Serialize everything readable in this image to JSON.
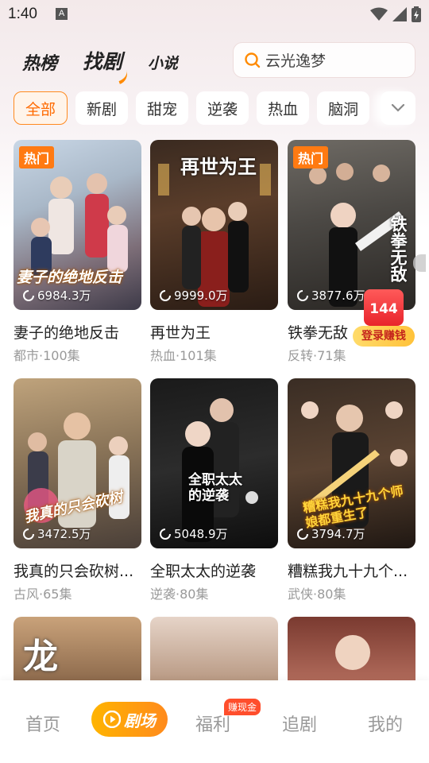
{
  "status_bar": {
    "time": "1:40",
    "notif_glyph": "A"
  },
  "header": {
    "tabs": [
      "热榜",
      "找剧",
      "小说"
    ],
    "active_tab": "找剧",
    "search_placeholder": "云光逸梦"
  },
  "categories": [
    "全部",
    "新剧",
    "甜宠",
    "逆袭",
    "热血",
    "脑洞"
  ],
  "active_category": "全部",
  "dramas": [
    {
      "title": "妻子的绝地反击",
      "genre": "都市",
      "episodes": "100集",
      "meta": "都市·100集",
      "views": "6984.3万",
      "hot": "热门",
      "poster_text": "妻子的绝地反击"
    },
    {
      "title": "再世为王",
      "genre": "热血",
      "episodes": "101集",
      "meta": "热血·101集",
      "views": "9999.0万",
      "hot": "",
      "poster_text": "再世为王"
    },
    {
      "title": "铁拳无敌",
      "genre": "反转",
      "episodes": "71集",
      "meta": "反转·71集",
      "views": "3877.6万",
      "hot": "热门",
      "poster_text": "铁拳无敌"
    },
    {
      "title": "我真的只会砍树...",
      "genre": "古风",
      "episodes": "65集",
      "meta": "古风·65集",
      "views": "3472.5万",
      "hot": "",
      "poster_text": "我真的只会砍树"
    },
    {
      "title": "全职太太的逆袭",
      "genre": "逆袭",
      "episodes": "80集",
      "meta": "逆袭·80集",
      "views": "5048.9万",
      "hot": "",
      "poster_text": "全职太太的逆袭"
    },
    {
      "title": "糟糕我九十九个...",
      "genre": "武侠",
      "episodes": "80集",
      "meta": "武侠·80集",
      "views": "3794.7万",
      "hot": "",
      "poster_text": "糟糕我九十九个师娘都重生了"
    }
  ],
  "partial_posters": [
    {
      "poster_text": "龙"
    },
    {
      "poster_text": ""
    },
    {
      "poster_text": ""
    }
  ],
  "earn_widget": {
    "count": "144",
    "label": "登录赚钱"
  },
  "bottom_nav": {
    "items": [
      "首页",
      "剧场",
      "福利",
      "追剧",
      "我的"
    ],
    "active": "剧场",
    "welfare_badge": "赚现金"
  },
  "colors": {
    "accent": "#ff8a00",
    "hot_badge": "#ff7a12",
    "earn_red": "#e8242b"
  }
}
